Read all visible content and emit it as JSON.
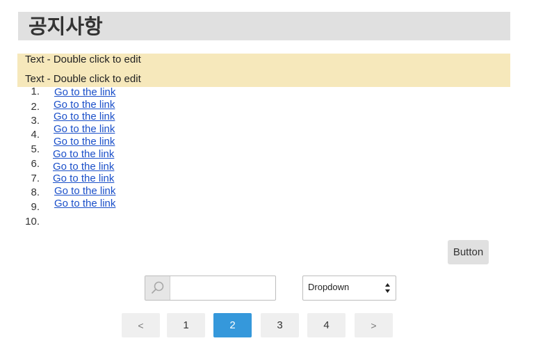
{
  "header": {
    "title": "공지사항"
  },
  "notes": [
    "Text - Double click to edit",
    "Text - Double click to edit"
  ],
  "list": {
    "items": [
      {
        "num": "1.",
        "link": "Go to the link"
      },
      {
        "num": "2.",
        "link": "Go to the link"
      },
      {
        "num": "3.",
        "link": "Go to the link"
      },
      {
        "num": "4.",
        "link": "Go to the link"
      },
      {
        "num": "5.",
        "link": "Go to the link"
      },
      {
        "num": "6.",
        "link": "Go to the link"
      },
      {
        "num": "7.",
        "link": "Go to the link"
      },
      {
        "num": "8.",
        "link": "Go to the link"
      },
      {
        "num": "9.",
        "link": "Go to the link"
      },
      {
        "num": "10.",
        "link": "Go to the link"
      }
    ]
  },
  "button": {
    "label": "Button"
  },
  "search": {
    "value": "",
    "placeholder": ""
  },
  "dropdown": {
    "selected": "Dropdown"
  },
  "pagination": {
    "prev": "<",
    "pages": [
      "1",
      "2",
      "3",
      "4"
    ],
    "active_page": "2",
    "next": ">"
  },
  "colors": {
    "accent": "#3598db",
    "link": "#1a4fc9",
    "note_bg": "#f6e8bb",
    "title_bg": "#e0e0e0"
  }
}
